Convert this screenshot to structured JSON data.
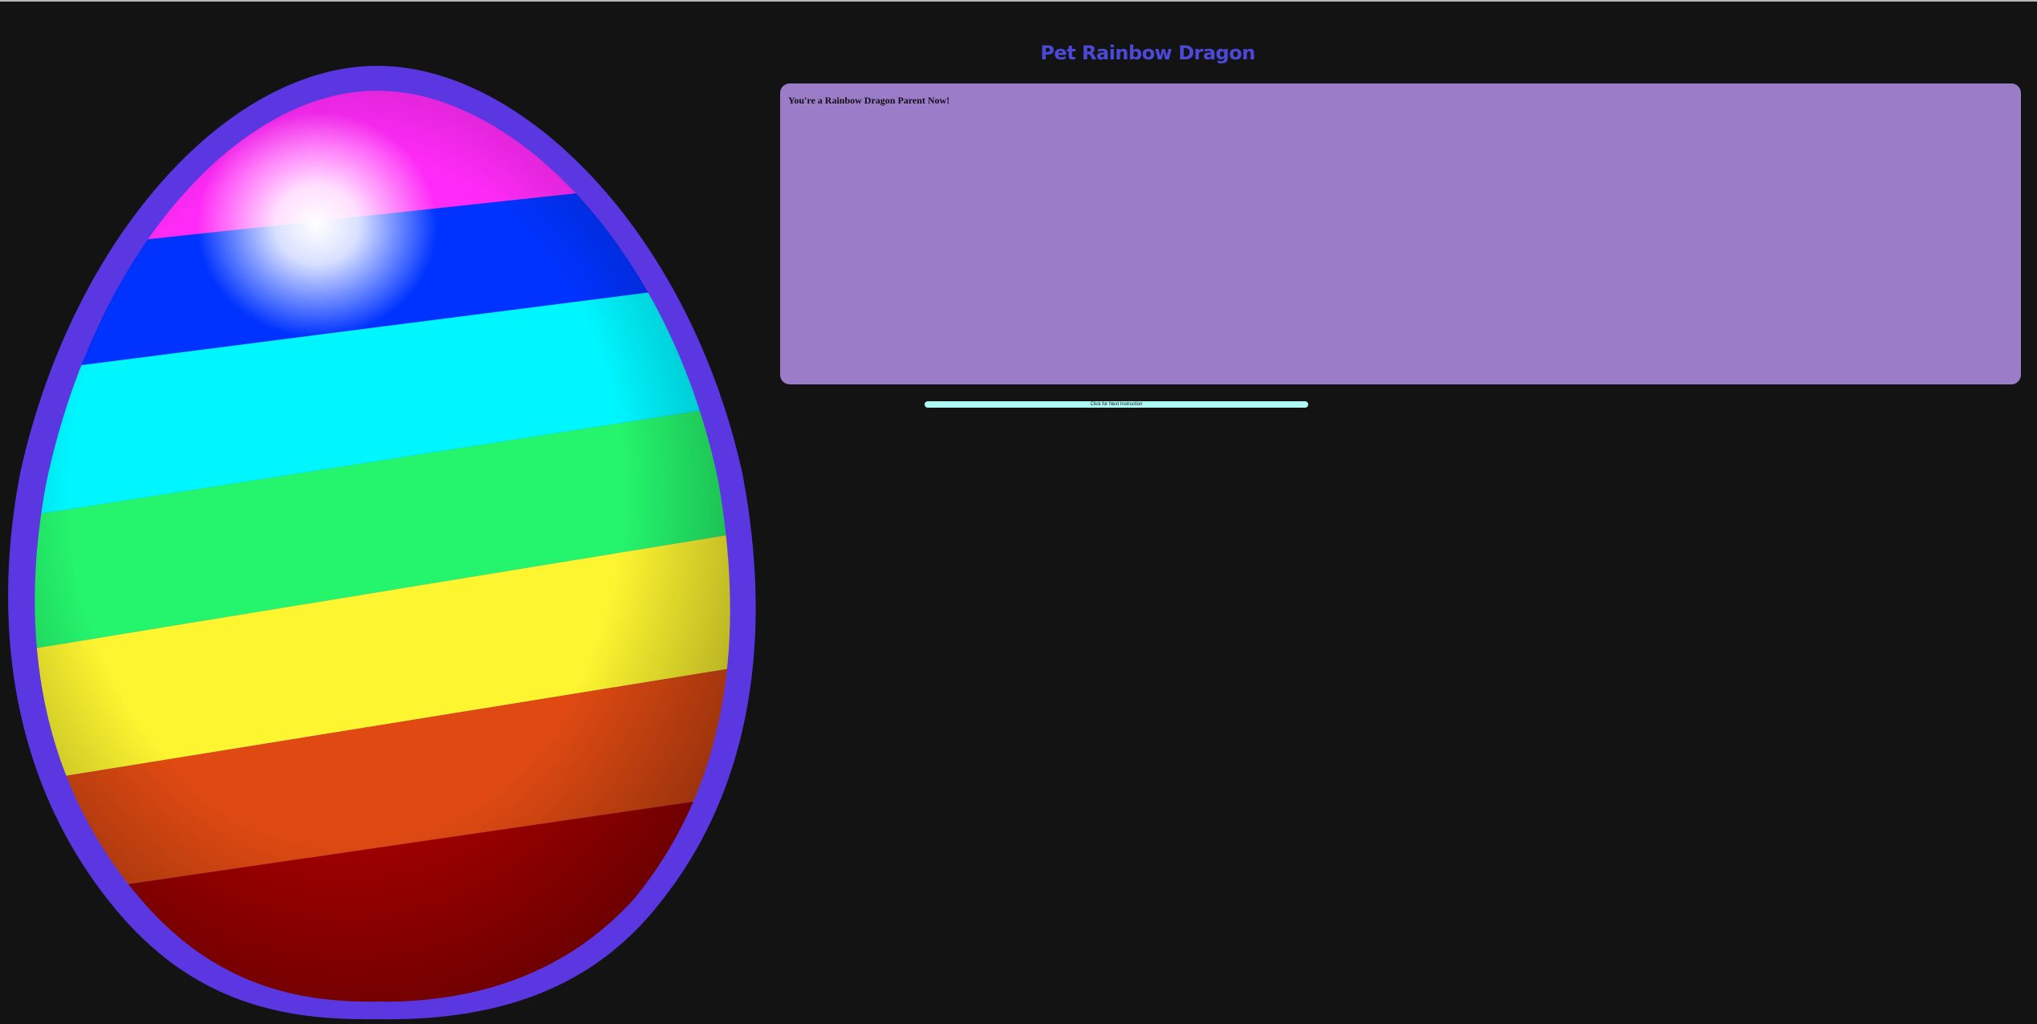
{
  "app": {
    "title": "Pet Rainbow Dragon"
  },
  "dialog": {
    "message": "You're a Rainbow Dragon Parent Now!"
  },
  "controls": {
    "next_label": "Click for Next Instruction"
  },
  "egg": {
    "icon": "rainbow-egg-image",
    "shell_color": "#5a37e0",
    "stripes": [
      "#ff2af7",
      "#0033ff",
      "#00f6ff",
      "#25f56c",
      "#fdf530",
      "#e04a12",
      "#a00000"
    ]
  },
  "colors": {
    "background": "#141314",
    "title": "#4b49d6",
    "panel": "#9b7cc9",
    "button": "#aefaf4"
  }
}
